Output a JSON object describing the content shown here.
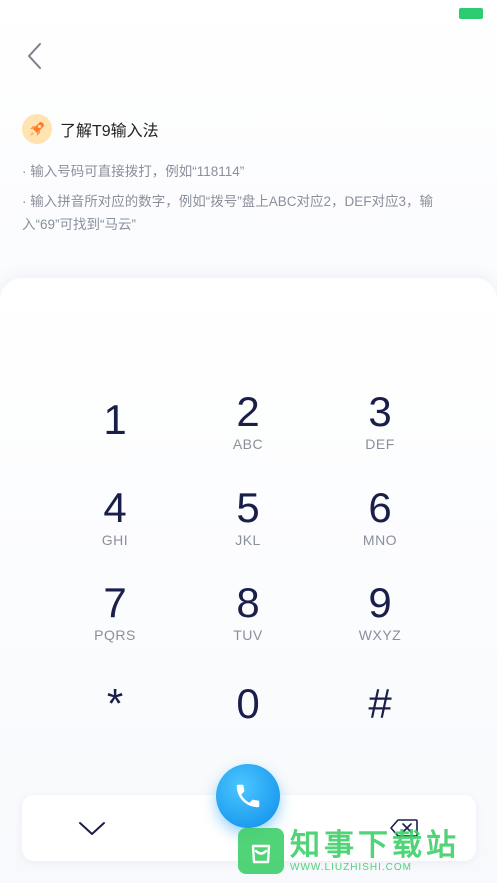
{
  "status": {
    "battery_label": ""
  },
  "t9": {
    "title": "了解T9输入法",
    "tip1": "· 输入号码可直接拨打，例如“118114”",
    "tip2": "· 输入拼音所对应的数字，例如“拨号”盘上ABC对应2，DEF对应3，输入“69”可找到“马云”"
  },
  "keypad": {
    "keys": [
      {
        "num": "1",
        "letters": ""
      },
      {
        "num": "2",
        "letters": "ABC"
      },
      {
        "num": "3",
        "letters": "DEF"
      },
      {
        "num": "4",
        "letters": "GHI"
      },
      {
        "num": "5",
        "letters": "JKL"
      },
      {
        "num": "6",
        "letters": "MNO"
      },
      {
        "num": "7",
        "letters": "PQRS"
      },
      {
        "num": "8",
        "letters": "TUV"
      },
      {
        "num": "9",
        "letters": "WXYZ"
      },
      {
        "num": "*",
        "letters": ""
      },
      {
        "num": "0",
        "letters": ""
      },
      {
        "num": "#",
        "letters": ""
      }
    ]
  },
  "icons": {
    "back": "chevron-left-icon",
    "rocket": "rocket-icon",
    "collapse": "chevron-down-icon",
    "call": "phone-icon",
    "delete": "backspace-icon"
  },
  "colors": {
    "accent": "#1f9df0",
    "key_text": "#1a1f4a",
    "sub_text": "#8a8f9c",
    "battery": "#2ecc71"
  },
  "watermark": {
    "cn": "知事下载站",
    "en": "WWW.LIUZHISHI.COM"
  }
}
